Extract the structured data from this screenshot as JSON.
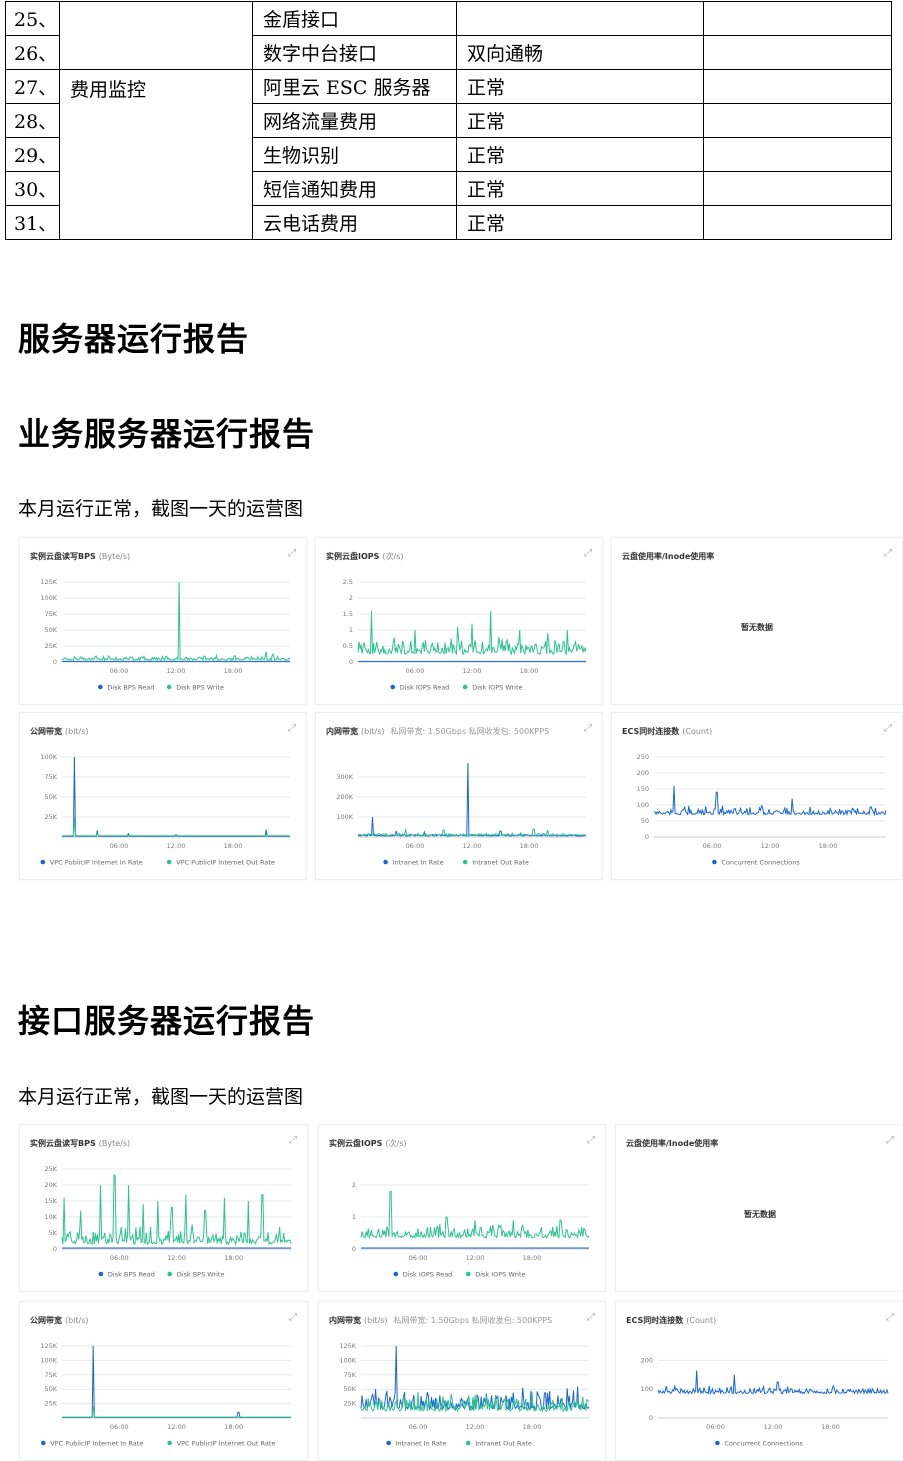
{
  "table": {
    "rows": [
      {
        "idx": "25、",
        "name": "金盾接口",
        "status": ""
      },
      {
        "idx": "26、",
        "name": "数字中台接口",
        "status": "双向通畅"
      },
      {
        "idx": "27、",
        "name": "阿里云 ESC 服务器",
        "status": "正常"
      },
      {
        "idx": "28、",
        "name": "网络流量费用",
        "status": "正常"
      },
      {
        "idx": "29、",
        "name": "生物识别",
        "status": "正常"
      },
      {
        "idx": "30、",
        "name": "短信通知费用",
        "status": "正常"
      },
      {
        "idx": "31、",
        "name": "云电话费用",
        "status": "正常"
      }
    ],
    "category": "费用监控"
  },
  "headings": {
    "server_report": "服务器运行报告",
    "business_report": "业务服务器运行报告",
    "interface_report": "接口服务器运行报告"
  },
  "paragraphs": {
    "business_note": "本月运行正常，截图一天的运营图",
    "interface_note": "本月运行正常，截图一天的运营图"
  },
  "colors": {
    "read": "#1a67d2",
    "write": "#2ec28f",
    "grid": "#e6e8eb",
    "axis": "#7a7a7a"
  },
  "icons": {
    "expand": "expand-icon"
  },
  "business_panels": {
    "bps": {
      "title": "实例云盘读写BPS",
      "unit": "(Byte/s)"
    },
    "iops": {
      "title": "实例云盘IOPS",
      "unit": "(次/s)"
    },
    "disk": {
      "title": "云盘使用率/Inode使用率",
      "nodata": "暂无数据"
    },
    "public_bw": {
      "title": "公网带宽",
      "unit": "(bit/s)"
    },
    "intranet_bw": {
      "title": "内网带宽",
      "unit": "(bit/s)",
      "extra": "私网带宽: 1.50Gbps  私网收发包: 500KPPS"
    },
    "connections": {
      "title": "ECS同时连接数",
      "unit": "(Count)"
    }
  },
  "interface_panels": {
    "bps": {
      "title": "实例云盘读写BPS",
      "unit": "(Byte/s)"
    },
    "iops": {
      "title": "实例云盘IOPS",
      "unit": "(次/s)"
    },
    "disk": {
      "title": "云盘使用率/Inode使用率",
      "nodata": "暂无数据"
    },
    "public_bw": {
      "title": "公网带宽",
      "unit": "(bit/s)"
    },
    "intranet_bw": {
      "title": "内网带宽",
      "unit": "(bit/s)",
      "extra": "私网带宽: 1.50Gbps  私网收发包: 500KPPS"
    },
    "connections": {
      "title": "ECS同时连接数",
      "unit": "(Count)"
    }
  },
  "chart_data": [
    {
      "id": "b_bps",
      "type": "line",
      "ylim": [
        0,
        125000
      ],
      "yticks": [
        0,
        25000,
        50000,
        75000,
        100000,
        125000
      ],
      "ytick_labels": [
        "0",
        "25K",
        "50K",
        "75K",
        "100K",
        "125K"
      ],
      "xticks": [
        "06:00",
        "12:00",
        "18:00"
      ],
      "xlim_hours": [
        0,
        24
      ],
      "series": [
        {
          "name": "Disk BPS Read",
          "color": "#1a67d2",
          "base": 1000,
          "spikes": []
        },
        {
          "name": "Disk BPS Write",
          "color": "#2ec28f",
          "base": 3000,
          "noise": 5000,
          "spikes": [
            [
              2.0,
              8000
            ],
            [
              5.0,
              7000
            ],
            [
              8.5,
              6000
            ],
            [
              12.3,
              125000
            ],
            [
              15.0,
              9000
            ],
            [
              18.5,
              6000
            ],
            [
              21.5,
              16000
            ],
            [
              22.2,
              12000
            ]
          ]
        }
      ]
    },
    {
      "id": "b_iops",
      "type": "line",
      "ylim": [
        0,
        2.5
      ],
      "yticks": [
        0,
        0.5,
        1,
        1.5,
        2,
        2.5
      ],
      "ytick_labels": [
        "0",
        "0.5",
        "1",
        "1.5",
        "2",
        "2.5"
      ],
      "xticks": [
        "06:00",
        "12:00",
        "18:00"
      ],
      "xlim_hours": [
        0,
        24
      ],
      "series": [
        {
          "name": "Disk IOPS Read",
          "color": "#1a67d2",
          "base": 0.02,
          "spikes": []
        },
        {
          "name": "Disk IOPS Write",
          "color": "#2ec28f",
          "base": 0.25,
          "noise": 0.35,
          "spikes": [
            [
              1.4,
              1.6
            ],
            [
              6.0,
              1.0
            ],
            [
              10.5,
              1.1
            ],
            [
              12.0,
              1.2
            ],
            [
              14.0,
              1.6
            ],
            [
              17.0,
              1.0
            ],
            [
              20.0,
              0.9
            ],
            [
              22.0,
              1.0
            ]
          ]
        }
      ]
    },
    {
      "id": "b_pub",
      "type": "line",
      "ylim": [
        0,
        100000
      ],
      "yticks": [
        25000,
        50000,
        75000,
        100000
      ],
      "ytick_labels": [
        "25K",
        "50K",
        "75K",
        "100K"
      ],
      "xticks": [
        "06:00",
        "12:00",
        "18:00"
      ],
      "xlim_hours": [
        0,
        24
      ],
      "series": [
        {
          "name": "VPC PublicIP Internet In Rate",
          "color": "#1a67d2",
          "base": 1000,
          "spikes": [
            [
              1.3,
              100000
            ],
            [
              3.7,
              8000
            ],
            [
              7.0,
              4000
            ],
            [
              12.0,
              3000
            ],
            [
              21.5,
              9000
            ]
          ]
        },
        {
          "name": "VPC PublicIP Internet Out Rate",
          "color": "#2ec28f",
          "base": 1500,
          "spikes": [
            [
              1.3,
              25000
            ],
            [
              3.7,
              5000
            ]
          ]
        }
      ]
    },
    {
      "id": "b_int",
      "type": "line",
      "ylim": [
        0,
        400000
      ],
      "yticks": [
        100000,
        200000,
        300000
      ],
      "ytick_labels": [
        "100K",
        "200K",
        "300K"
      ],
      "xticks": [
        "06:00",
        "12:00",
        "18:00"
      ],
      "xlim_hours": [
        0,
        24
      ],
      "series": [
        {
          "name": "Intranet In Rate",
          "color": "#1a67d2",
          "base": 5000,
          "noise": 6000,
          "spikes": [
            [
              1.5,
              100000
            ],
            [
              11.6,
              370000
            ],
            [
              4.0,
              30000
            ],
            [
              7.0,
              25000
            ],
            [
              15.0,
              30000
            ]
          ]
        },
        {
          "name": "Intranet Out Rate",
          "color": "#2ec28f",
          "base": 8000,
          "noise": 8000,
          "spikes": [
            [
              5.0,
              40000
            ],
            [
              9.0,
              35000
            ],
            [
              18.5,
              40000
            ],
            [
              20.0,
              35000
            ]
          ]
        }
      ]
    },
    {
      "id": "b_conn",
      "type": "line",
      "ylim": [
        0,
        250
      ],
      "yticks": [
        0,
        50,
        100,
        150,
        200,
        250
      ],
      "ytick_labels": [
        "0",
        "50",
        "100",
        "150",
        "200",
        "250"
      ],
      "xticks": [
        "06:00",
        "12:00",
        "18:00"
      ],
      "xlim_hours": [
        0,
        24
      ],
      "series": [
        {
          "name": "Concurrent Connections",
          "color": "#1a67d2",
          "base": 70,
          "noise": 18,
          "spikes": [
            [
              2.1,
              160
            ],
            [
              6.5,
              140
            ],
            [
              14.3,
              120
            ]
          ]
        }
      ]
    },
    {
      "id": "i_bps",
      "type": "line",
      "ylim": [
        0,
        25000
      ],
      "yticks": [
        0,
        5000,
        10000,
        15000,
        20000,
        25000
      ],
      "ytick_labels": [
        "0",
        "5K",
        "10K",
        "15K",
        "20K",
        "25K"
      ],
      "xticks": [
        "06:00",
        "12:00",
        "18:00"
      ],
      "xlim_hours": [
        0,
        24
      ],
      "series": [
        {
          "name": "Disk BPS Read",
          "color": "#1a67d2",
          "base": 300,
          "spikes": []
        },
        {
          "name": "Disk BPS Write",
          "color": "#2ec28f",
          "base": 1500,
          "noise": 4000,
          "spikes": [
            [
              0.2,
              16000
            ],
            [
              2.0,
              12000
            ],
            [
              4.0,
              20000
            ],
            [
              5.5,
              23000
            ],
            [
              7.0,
              20000
            ],
            [
              8.5,
              14000
            ],
            [
              10.0,
              15000
            ],
            [
              11.5,
              13000
            ],
            [
              13.0,
              17000
            ],
            [
              15.0,
              12000
            ],
            [
              17.0,
              16000
            ],
            [
              19.5,
              15000
            ],
            [
              21.0,
              17000
            ]
          ]
        }
      ]
    },
    {
      "id": "i_iops",
      "type": "line",
      "ylim": [
        0,
        2.5
      ],
      "yticks": [
        0,
        1,
        2
      ],
      "ytick_labels": [
        "0",
        "1",
        "2"
      ],
      "xticks": [
        "06:00",
        "12:00",
        "18:00"
      ],
      "xlim_hours": [
        0,
        24
      ],
      "series": [
        {
          "name": "Disk IOPS Read",
          "color": "#1a67d2",
          "base": 0.03,
          "spikes": []
        },
        {
          "name": "Disk IOPS Write",
          "color": "#2ec28f",
          "base": 0.35,
          "noise": 0.3,
          "spikes": [
            [
              3.1,
              1.8
            ],
            [
              9.0,
              1.0
            ],
            [
              12.0,
              0.9
            ],
            [
              16.0,
              0.9
            ],
            [
              21.0,
              0.9
            ]
          ]
        }
      ]
    },
    {
      "id": "i_pub",
      "type": "line",
      "ylim": [
        0,
        125000
      ],
      "yticks": [
        25000,
        50000,
        75000,
        100000,
        125000
      ],
      "ytick_labels": [
        "25K",
        "50K",
        "75K",
        "100K",
        "125K"
      ],
      "xticks": [
        "06:00",
        "12:00",
        "18:00"
      ],
      "xlim_hours": [
        0,
        24
      ],
      "series": [
        {
          "name": "VPC PublicIP Internet In Rate",
          "color": "#1a67d2",
          "base": 1000,
          "spikes": [
            [
              3.3,
              125000
            ],
            [
              18.5,
              10000
            ]
          ]
        },
        {
          "name": "VPC PublicIP Internet Out Rate",
          "color": "#2ec28f",
          "base": 1500,
          "spikes": [
            [
              3.3,
              20000
            ]
          ]
        }
      ]
    },
    {
      "id": "i_int",
      "type": "line",
      "ylim": [
        0,
        125000
      ],
      "yticks": [
        25000,
        50000,
        75000,
        100000,
        125000
      ],
      "ytick_labels": [
        "25K",
        "50K",
        "75K",
        "100K",
        "125K"
      ],
      "xticks": [
        "06:00",
        "12:00",
        "18:00"
      ],
      "xlim_hours": [
        0,
        24
      ],
      "series": [
        {
          "name": "Intranet In Rate",
          "color": "#1a67d2",
          "base": 15000,
          "noise": 25000,
          "spikes": [
            [
              3.7,
              125000
            ]
          ]
        },
        {
          "name": "Intranet Out Rate",
          "color": "#2ec28f",
          "base": 12000,
          "noise": 20000,
          "spikes": [
            [
              6.0,
              45000
            ],
            [
              12.0,
              40000
            ],
            [
              18.0,
              45000
            ]
          ]
        }
      ]
    },
    {
      "id": "i_conn",
      "type": "line",
      "ylim": [
        0,
        250
      ],
      "yticks": [
        0,
        100,
        200
      ],
      "ytick_labels": [
        "0",
        "100",
        "200"
      ],
      "xticks": [
        "06:00",
        "12:00",
        "18:00"
      ],
      "xlim_hours": [
        0,
        24
      ],
      "series": [
        {
          "name": "Concurrent Connections",
          "color": "#1a67d2",
          "base": 85,
          "noise": 18,
          "spikes": [
            [
              4.0,
              165
            ],
            [
              8.0,
              150
            ],
            [
              12.5,
              125
            ]
          ]
        }
      ]
    }
  ]
}
